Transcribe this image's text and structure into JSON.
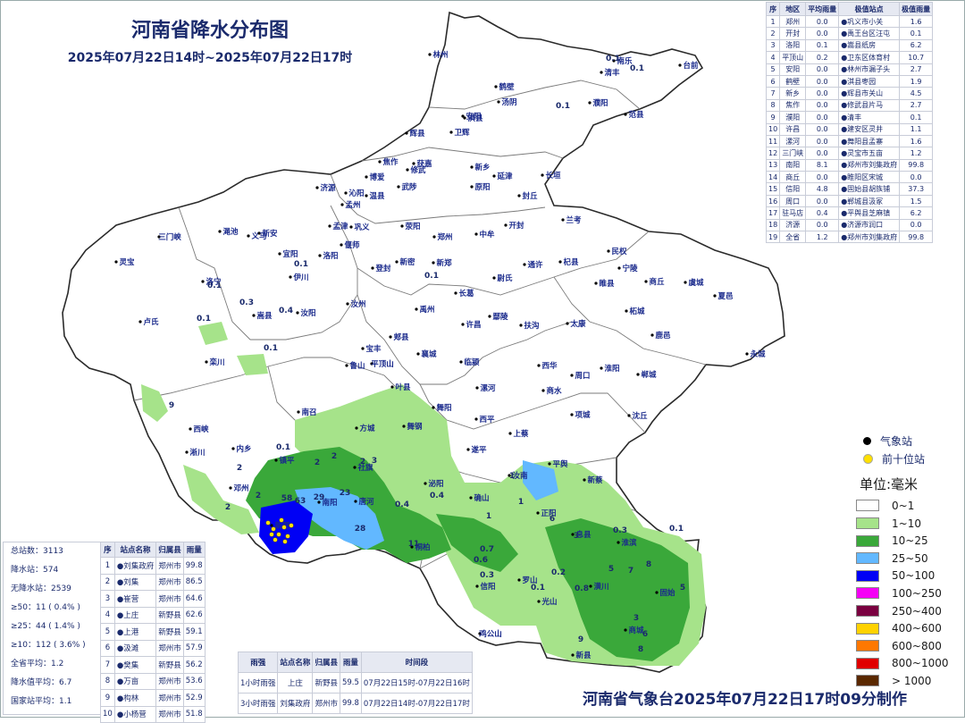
{
  "title": "河南省降水分布图",
  "subtitle": "2025年07月22日14时~2025年07月22日17时",
  "footer": "河南省气象台2025年07月22日17时09分制作",
  "city_table": {
    "headers": [
      "序",
      "地区",
      "平均雨量",
      "极值站点",
      "极值雨量"
    ],
    "rows": [
      [
        "1",
        "郑州",
        "0.0",
        "●巩义市小关",
        "1.6"
      ],
      [
        "2",
        "开封",
        "0.0",
        "●禹王台区汪屯",
        "0.1"
      ],
      [
        "3",
        "洛阳",
        "0.1",
        "●嵩县纸房",
        "6.2"
      ],
      [
        "4",
        "平顶山",
        "0.2",
        "●卫东区体育村",
        "10.7"
      ],
      [
        "5",
        "安阳",
        "0.0",
        "●林州市漏子头",
        "2.7"
      ],
      [
        "6",
        "鹤壁",
        "0.0",
        "●淇县枣园",
        "1.9"
      ],
      [
        "7",
        "新乡",
        "0.0",
        "●辉县市关山",
        "4.5"
      ],
      [
        "8",
        "焦作",
        "0.0",
        "●修武县片马",
        "2.7"
      ],
      [
        "9",
        "濮阳",
        "0.0",
        "●清丰",
        "0.1"
      ],
      [
        "10",
        "许昌",
        "0.0",
        "●建安区灵井",
        "1.1"
      ],
      [
        "11",
        "漯河",
        "0.0",
        "●舞阳县孟寨",
        "1.6"
      ],
      [
        "12",
        "三门峡",
        "0.0",
        "●灵宝市五亩",
        "1.2"
      ],
      [
        "13",
        "南阳",
        "8.1",
        "●郑州市刘集政府",
        "99.8"
      ],
      [
        "14",
        "商丘",
        "0.0",
        "●睢阳区宋城",
        "0.0"
      ],
      [
        "15",
        "信阳",
        "4.8",
        "●固始县胡族铺",
        "37.3"
      ],
      [
        "16",
        "周口",
        "0.0",
        "●郸城县汲冢",
        "1.5"
      ],
      [
        "17",
        "驻马店",
        "0.4",
        "●平舆县芝麻镇",
        "6.2"
      ],
      [
        "18",
        "济源",
        "0.0",
        "●济源市润口",
        "0.0"
      ],
      [
        "19",
        "全省",
        "1.2",
        "●郑州市刘集政府",
        "99.8"
      ]
    ]
  },
  "stats": [
    "总站数：3113",
    "降水站：574",
    "无降水站：2539",
    "≥50：11 ( 0.4% )",
    "≥25：44 ( 1.4% )",
    "≥10：112 ( 3.6% )",
    "全省平均：1.2",
    "降水值平均：6.7",
    "国家站平均：1.1"
  ],
  "top10": {
    "headers": [
      "序",
      "站点名称",
      "归属县",
      "雨量"
    ],
    "rows": [
      [
        "1",
        "●刘集政府",
        "郑州市",
        "99.8"
      ],
      [
        "2",
        "●刘集",
        "郑州市",
        "86.5"
      ],
      [
        "3",
        "●崔营",
        "郑州市",
        "64.6"
      ],
      [
        "4",
        "●上庄",
        "新野县",
        "62.6"
      ],
      [
        "5",
        "●上港",
        "新野县",
        "59.1"
      ],
      [
        "6",
        "●汲滩",
        "郑州市",
        "57.9"
      ],
      [
        "7",
        "●樊集",
        "新野县",
        "56.2"
      ],
      [
        "8",
        "●万亩",
        "郑州市",
        "53.6"
      ],
      [
        "9",
        "●构林",
        "郑州市",
        "52.9"
      ],
      [
        "10",
        "●小杨营",
        "郑州市",
        "51.8"
      ]
    ]
  },
  "max_rain": {
    "headers": [
      "雨强",
      "站点名称",
      "归属县",
      "雨量",
      "时间段"
    ],
    "rows": [
      [
        "1小时雨强",
        "上庄",
        "新野县",
        "59.5",
        "07月22日15时-07月22日16时"
      ],
      [
        "3小时雨强",
        "刘集政府",
        "郑州市",
        "99.8",
        "07月22日14时-07月22日17时"
      ]
    ]
  },
  "legend": {
    "station_label": "气象站",
    "top10_label": "前十位站",
    "unit": "单位:毫米",
    "station_color": "#000000",
    "top10_color": "#ffe000",
    "classes": [
      {
        "label": "0~1",
        "color": "#ffffff"
      },
      {
        "label": "1~10",
        "color": "#a6e38a"
      },
      {
        "label": "10~25",
        "color": "#3aa83a"
      },
      {
        "label": "25~50",
        "color": "#62b8ff"
      },
      {
        "label": "50~100",
        "color": "#0000f5"
      },
      {
        "label": "100~250",
        "color": "#f500f5"
      },
      {
        "label": "250~400",
        "color": "#7a0040"
      },
      {
        "label": "400~600",
        "color": "#ffd200"
      },
      {
        "label": "600~800",
        "color": "#ff7800"
      },
      {
        "label": "800~1000",
        "color": "#e00000"
      },
      {
        "label": "> 1000",
        "color": "#5a2800"
      }
    ]
  },
  "map_labels": [
    {
      "text": "安阳",
      "ex": 530,
      "ey": 133
    },
    {
      "text": "林州",
      "ex": 493,
      "ey": 64
    },
    {
      "text": "汤阴",
      "ex": 570,
      "ey": 117
    },
    {
      "text": "鹤壁",
      "ex": 567,
      "ey": 100
    },
    {
      "text": "淇县",
      "ex": 532,
      "ey": 135
    },
    {
      "text": "濮阳",
      "ex": 672,
      "ey": 118
    },
    {
      "text": "清丰",
      "ex": 685,
      "ey": 84
    },
    {
      "text": "南乐",
      "ex": 699,
      "ey": 71
    },
    {
      "text": "台前",
      "ex": 773,
      "ey": 76
    },
    {
      "text": "范县",
      "ex": 712,
      "ey": 131
    },
    {
      "text": "新乡",
      "ex": 540,
      "ey": 190
    },
    {
      "text": "卫辉",
      "ex": 517,
      "ey": 151
    },
    {
      "text": "辉县",
      "ex": 467,
      "ey": 152
    },
    {
      "text": "获嘉",
      "ex": 475,
      "ey": 186
    },
    {
      "text": "原阳",
      "ex": 540,
      "ey": 212
    },
    {
      "text": "延津",
      "ex": 565,
      "ey": 200
    },
    {
      "text": "封丘",
      "ex": 593,
      "ey": 222
    },
    {
      "text": "长垣",
      "ex": 619,
      "ey": 199
    },
    {
      "text": "焦作",
      "ex": 437,
      "ey": 184
    },
    {
      "text": "博爱",
      "ex": 422,
      "ey": 201
    },
    {
      "text": "修武",
      "ex": 468,
      "ey": 193
    },
    {
      "text": "武陟",
      "ex": 458,
      "ey": 212
    },
    {
      "text": "温县",
      "ex": 422,
      "ey": 222
    },
    {
      "text": "沁阳",
      "ex": 399,
      "ey": 219
    },
    {
      "text": "济源",
      "ex": 367,
      "ey": 213
    },
    {
      "text": "孟州",
      "ex": 395,
      "ey": 232
    },
    {
      "text": "郑州",
      "ex": 498,
      "ey": 268
    },
    {
      "text": "荥阳",
      "ex": 462,
      "ey": 256
    },
    {
      "text": "中牟",
      "ex": 545,
      "ey": 265
    },
    {
      "text": "新郑",
      "ex": 497,
      "ey": 297
    },
    {
      "text": "新密",
      "ex": 456,
      "ey": 296
    },
    {
      "text": "登封",
      "ex": 429,
      "ey": 303
    },
    {
      "text": "巩义",
      "ex": 405,
      "ey": 257
    },
    {
      "text": "开封",
      "ex": 578,
      "ey": 255
    },
    {
      "text": "兰考",
      "ex": 642,
      "ey": 249
    },
    {
      "text": "杞县",
      "ex": 639,
      "ey": 296
    },
    {
      "text": "通许",
      "ex": 599,
      "ey": 299
    },
    {
      "text": "尉氏",
      "ex": 565,
      "ey": 314
    },
    {
      "text": "商丘",
      "ex": 735,
      "ey": 318
    },
    {
      "text": "民权",
      "ex": 693,
      "ey": 284
    },
    {
      "text": "宁陵",
      "ex": 705,
      "ey": 303
    },
    {
      "text": "睢县",
      "ex": 679,
      "ey": 320
    },
    {
      "text": "柘城",
      "ex": 713,
      "ey": 351
    },
    {
      "text": "虞城",
      "ex": 779,
      "ey": 319
    },
    {
      "text": "夏邑",
      "ex": 812,
      "ey": 334
    },
    {
      "text": "永城",
      "ex": 848,
      "ey": 399
    },
    {
      "text": "洛阳",
      "ex": 370,
      "ey": 289
    },
    {
      "text": "孟津",
      "ex": 381,
      "ey": 256
    },
    {
      "text": "新安",
      "ex": 302,
      "ey": 264
    },
    {
      "text": "偃师",
      "ex": 394,
      "ey": 277
    },
    {
      "text": "伊川",
      "ex": 337,
      "ey": 313
    },
    {
      "text": "汝阳",
      "ex": 345,
      "ey": 353
    },
    {
      "text": "宜阳",
      "ex": 325,
      "ey": 287
    },
    {
      "text": "洛宁",
      "ex": 239,
      "ey": 318
    },
    {
      "text": "嵩县",
      "ex": 296,
      "ey": 356
    },
    {
      "text": "栾川",
      "ex": 243,
      "ey": 408
    },
    {
      "text": "三门峡",
      "ex": 190,
      "ey": 268
    },
    {
      "text": "灵宝",
      "ex": 142,
      "ey": 296
    },
    {
      "text": "卢氏",
      "ex": 169,
      "ey": 363
    },
    {
      "text": "渑池",
      "ex": 258,
      "ey": 262
    },
    {
      "text": "义马",
      "ex": 290,
      "ey": 267
    },
    {
      "text": "许昌",
      "ex": 530,
      "ey": 366
    },
    {
      "text": "禹州",
      "ex": 478,
      "ey": 349
    },
    {
      "text": "长葛",
      "ex": 522,
      "ey": 331
    },
    {
      "text": "鄢陵",
      "ex": 560,
      "ey": 357
    },
    {
      "text": "襄城",
      "ex": 480,
      "ey": 399
    },
    {
      "text": "平顶山",
      "ex": 428,
      "ey": 410
    },
    {
      "text": "宝丰",
      "ex": 418,
      "ey": 393
    },
    {
      "text": "郏县",
      "ex": 449,
      "ey": 380
    },
    {
      "text": "鲁山",
      "ex": 400,
      "ey": 412
    },
    {
      "text": "叶县",
      "ex": 451,
      "ey": 436
    },
    {
      "text": "舞钢",
      "ex": 464,
      "ey": 480
    },
    {
      "text": "汝州",
      "ex": 401,
      "ey": 343
    },
    {
      "text": "漯河",
      "ex": 546,
      "ey": 437
    },
    {
      "text": "临颍",
      "ex": 528,
      "ey": 408
    },
    {
      "text": "舞阳",
      "ex": 497,
      "ey": 459
    },
    {
      "text": "周口",
      "ex": 652,
      "ey": 423
    },
    {
      "text": "扶沟",
      "ex": 595,
      "ey": 367
    },
    {
      "text": "西华",
      "ex": 615,
      "ey": 412
    },
    {
      "text": "商水",
      "ex": 620,
      "ey": 440
    },
    {
      "text": "太康",
      "ex": 647,
      "ey": 365
    },
    {
      "text": "淮阳",
      "ex": 685,
      "ey": 415
    },
    {
      "text": "郸城",
      "ex": 726,
      "ey": 422
    },
    {
      "text": "鹿邑",
      "ex": 742,
      "ey": 378
    },
    {
      "text": "沈丘",
      "ex": 716,
      "ey": 468
    },
    {
      "text": "项城",
      "ex": 652,
      "ey": 467
    },
    {
      "text": "西平",
      "ex": 545,
      "ey": 472
    },
    {
      "text": "上蔡",
      "ex": 583,
      "ey": 488
    },
    {
      "text": "遂平",
      "ex": 536,
      "ey": 506
    },
    {
      "text": "汝南",
      "ex": 582,
      "ey": 535
    },
    {
      "text": "平舆",
      "ex": 627,
      "ey": 522
    },
    {
      "text": "新蔡",
      "ex": 666,
      "ey": 540
    },
    {
      "text": "正阳",
      "ex": 614,
      "ey": 577
    },
    {
      "text": "确山",
      "ex": 539,
      "ey": 560
    },
    {
      "text": "泌阳",
      "ex": 488,
      "ey": 544
    },
    {
      "text": "桐柏",
      "ex": 473,
      "ey": 615
    },
    {
      "text": "南阳",
      "ex": 369,
      "ey": 565
    },
    {
      "text": "方城",
      "ex": 411,
      "ey": 482
    },
    {
      "text": "社旗",
      "ex": 409,
      "ey": 526
    },
    {
      "text": "唐河",
      "ex": 410,
      "ey": 564
    },
    {
      "text": "新野",
      "ex": 316,
      "ey": 591
    },
    {
      "text": "邓州",
      "ex": 270,
      "ey": 549
    },
    {
      "text": "镇平",
      "ex": 321,
      "ey": 518
    },
    {
      "text": "内乡",
      "ex": 273,
      "ey": 505
    },
    {
      "text": "西峡",
      "ex": 225,
      "ey": 483
    },
    {
      "text": "淅川",
      "ex": 221,
      "ey": 509
    },
    {
      "text": "南召",
      "ex": 346,
      "ey": 464
    },
    {
      "text": "信阳",
      "ex": 546,
      "ey": 659
    },
    {
      "text": "罗山",
      "ex": 593,
      "ey": 652
    },
    {
      "text": "光山",
      "ex": 615,
      "ey": 676
    },
    {
      "text": "潢川",
      "ex": 673,
      "ey": 659
    },
    {
      "text": "息县",
      "ex": 653,
      "ey": 601
    },
    {
      "text": "淮滨",
      "ex": 704,
      "ey": 610
    },
    {
      "text": "固始",
      "ex": 747,
      "ey": 666
    },
    {
      "text": "商城",
      "ex": 712,
      "ey": 708
    },
    {
      "text": "新县",
      "ex": 653,
      "ey": 736
    },
    {
      "text": "鸡公山",
      "ex": 549,
      "ey": 712
    }
  ],
  "map_values": [
    {
      "text": "0.1",
      "ex": 713,
      "ey": 79
    },
    {
      "text": "0.1",
      "ex": 686,
      "ey": 68
    },
    {
      "text": "0.1",
      "ex": 630,
      "ey": 121
    },
    {
      "text": "0.1",
      "ex": 337,
      "ey": 298
    },
    {
      "text": "0.1",
      "ex": 483,
      "ey": 311
    },
    {
      "text": "0.1",
      "ex": 240,
      "ey": 322
    },
    {
      "text": "0.3",
      "ex": 276,
      "ey": 341
    },
    {
      "text": "0.4",
      "ex": 320,
      "ey": 350
    },
    {
      "text": "0.1",
      "ex": 228,
      "ey": 359
    },
    {
      "text": "0.1",
      "ex": 303,
      "ey": 392
    },
    {
      "text": "0.1",
      "ex": 317,
      "ey": 503
    },
    {
      "text": "2",
      "ex": 268,
      "ey": 526
    },
    {
      "text": "2",
      "ex": 355,
      "ey": 520
    },
    {
      "text": "2",
      "ex": 374,
      "ey": 513
    },
    {
      "text": "2",
      "ex": 406,
      "ey": 519
    },
    {
      "text": "3",
      "ex": 419,
      "ey": 518
    },
    {
      "text": "2",
      "ex": 289,
      "ey": 557
    },
    {
      "text": "2",
      "ex": 255,
      "ey": 570
    },
    {
      "text": "29",
      "ex": 357,
      "ey": 559
    },
    {
      "text": "23",
      "ex": 386,
      "ey": 554
    },
    {
      "text": "63",
      "ex": 336,
      "ey": 563
    },
    {
      "text": "58",
      "ex": 321,
      "ey": 560
    },
    {
      "text": "28",
      "ex": 403,
      "ey": 594
    },
    {
      "text": "11",
      "ex": 463,
      "ey": 611
    },
    {
      "text": "0.4",
      "ex": 489,
      "ey": 557
    },
    {
      "text": "0.4",
      "ex": 450,
      "ey": 567
    },
    {
      "text": "9",
      "ex": 192,
      "ey": 456
    },
    {
      "text": "1",
      "ex": 573,
      "ey": 535
    },
    {
      "text": "1",
      "ex": 547,
      "ey": 580
    },
    {
      "text": "1",
      "ex": 583,
      "ey": 564
    },
    {
      "text": "0.7",
      "ex": 545,
      "ey": 617
    },
    {
      "text": "0.6",
      "ex": 538,
      "ey": 629
    },
    {
      "text": "0.3",
      "ex": 545,
      "ey": 646
    },
    {
      "text": "0.2",
      "ex": 625,
      "ey": 643
    },
    {
      "text": "0.1",
      "ex": 602,
      "ey": 660
    },
    {
      "text": "0.8",
      "ex": 651,
      "ey": 661
    },
    {
      "text": "3",
      "ex": 645,
      "ey": 602
    },
    {
      "text": "6",
      "ex": 618,
      "ey": 583
    },
    {
      "text": "7",
      "ex": 706,
      "ey": 641
    },
    {
      "text": "5",
      "ex": 684,
      "ey": 639
    },
    {
      "text": "8",
      "ex": 726,
      "ey": 634
    },
    {
      "text": "3",
      "ex": 712,
      "ey": 694
    },
    {
      "text": "6",
      "ex": 722,
      "ey": 712
    },
    {
      "text": "8",
      "ex": 717,
      "ey": 729
    },
    {
      "text": "5",
      "ex": 764,
      "ey": 660
    },
    {
      "text": "9",
      "ex": 650,
      "ey": 718
    },
    {
      "text": "0.1",
      "ex": 757,
      "ey": 594
    },
    {
      "text": "0.3",
      "ex": 694,
      "ey": 596
    }
  ]
}
